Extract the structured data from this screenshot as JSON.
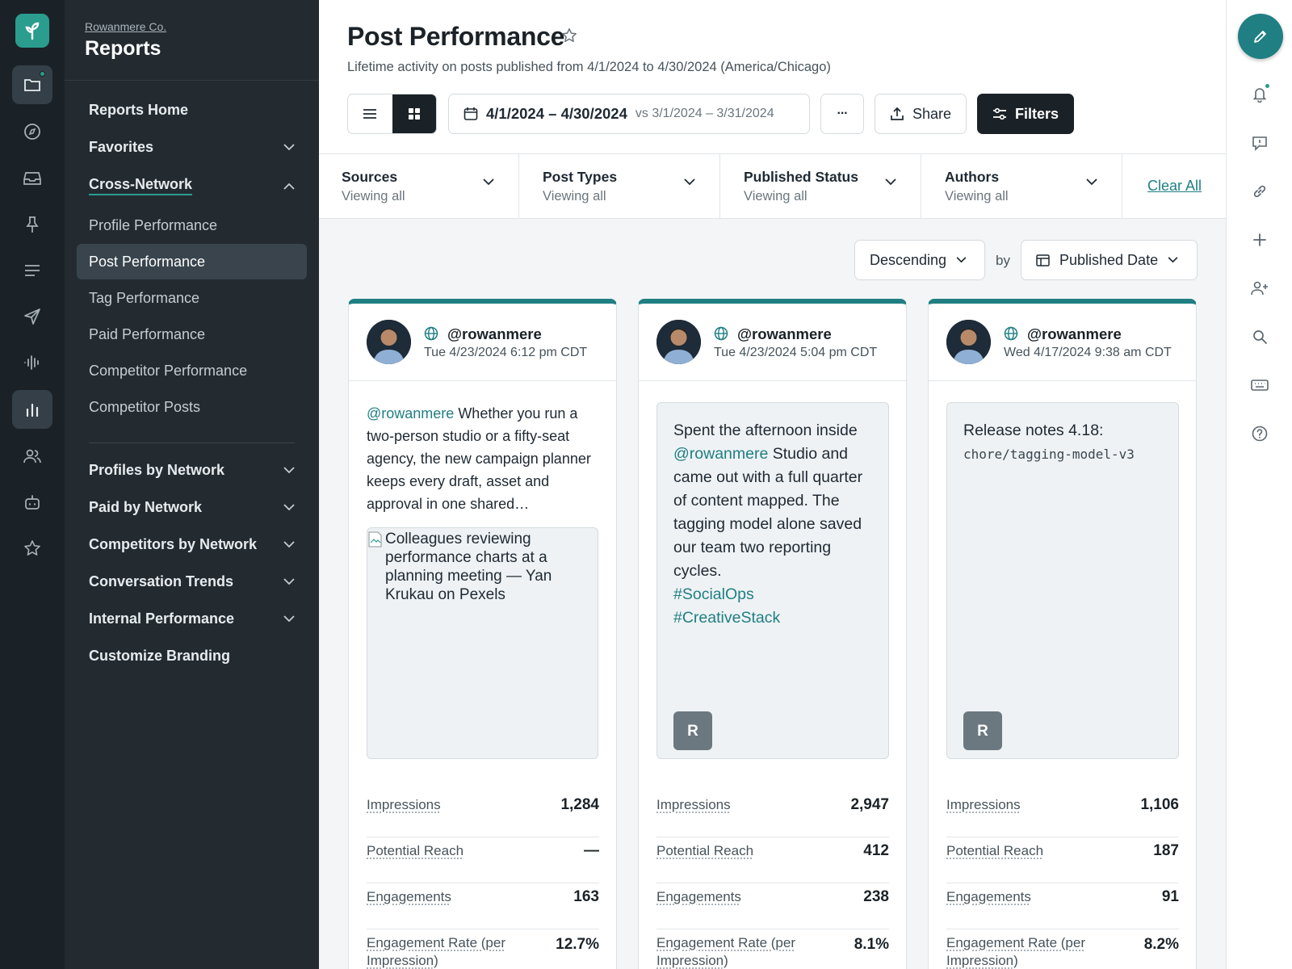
{
  "colors": {
    "accent": "#1f7f83",
    "rail_bg": "#1b2227",
    "nav_bg": "#232b31",
    "active_dark": "#1b2227"
  },
  "rail": {
    "icons": [
      "logo-icon",
      "folder-icon",
      "compass-icon",
      "inbox-icon",
      "pin-icon",
      "list-icon",
      "send-icon",
      "waveform-icon",
      "bar-chart-icon",
      "people-icon",
      "bot-icon",
      "star-icon"
    ]
  },
  "nav": {
    "org": "Rowanmere Co.",
    "title": "Reports",
    "items": {
      "reports_home": "Reports Home",
      "favorites": "Favorites",
      "cross_network": "Cross-Network",
      "profile_performance": "Profile Performance",
      "post_performance": "Post Performance",
      "tag_performance": "Tag Performance",
      "paid_performance": "Paid Performance",
      "competitor_performance": "Competitor Performance",
      "competitor_posts": "Competitor Posts",
      "profiles_by_network": "Profiles by Network",
      "paid_by_network": "Paid by Network",
      "competitors_by_network": "Competitors by Network",
      "conversation_trends": "Conversation Trends",
      "internal_performance": "Internal Performance",
      "customize_branding": "Customize Branding"
    }
  },
  "header": {
    "title": "Post Performance",
    "subtitle": "Lifetime activity on posts published from 4/1/2024 to 4/30/2024 (America/Chicago)",
    "date_range": "4/1/2024 – 4/30/2024",
    "compare_range": "vs 3/1/2024 – 3/31/2024",
    "more_label": "···",
    "share_label": "Share",
    "filters_label": "Filters"
  },
  "filters": {
    "sources": {
      "label": "Sources",
      "value": "Viewing all"
    },
    "post_types": {
      "label": "Post Types",
      "value": "Viewing all"
    },
    "published_status": {
      "label": "Published Status",
      "value": "Viewing all"
    },
    "authors": {
      "label": "Authors",
      "value": "Viewing all"
    },
    "clear_all": "Clear All"
  },
  "sort": {
    "order": "Descending",
    "by_label": "by",
    "field": "Published Date"
  },
  "cards": [
    {
      "handle": "@rowanmere",
      "time": "Tue 4/23/2024 6:12 pm CDT",
      "mention": "@rowanmere",
      "text": " Whether you run a two-person studio or a fifty-seat agency, the new campaign planner keeps every draft, asset and approval in one shared…",
      "image_alt": "Colleagues reviewing performance charts at a planning meeting — Yan Krukau on Pexels",
      "metrics": {
        "impressions_label": "Impressions",
        "impressions": "1,284",
        "reach_label": "Potential Reach",
        "reach": "—",
        "engagements_label": "Engagements",
        "engagements": "163",
        "rate_label": "Engagement Rate (per Impression)",
        "rate": "12.7%"
      }
    },
    {
      "handle": "@rowanmere",
      "time": "Tue 4/23/2024 5:04 pm CDT",
      "text_a": "Spent the afternoon inside ",
      "mention": "@rowanmere",
      "text_b": " Studio and came out with a full quarter of content mapped. The tagging model alone saved our team two reporting cycles.",
      "tag1": "#SocialOps",
      "tag2": "#CreativeStack",
      "badge": "R",
      "metrics": {
        "impressions_label": "Impressions",
        "impressions": "2,947",
        "reach_label": "Potential Reach",
        "reach": "412",
        "engagements_label": "Engagements",
        "engagements": "238",
        "rate_label": "Engagement Rate (per Impression)",
        "rate": "8.1%"
      }
    },
    {
      "handle": "@rowanmere",
      "time": "Wed 4/17/2024 9:38 am CDT",
      "text": "Release notes 4.18:",
      "code": "chore/tagging-model-v3",
      "badge": "R",
      "metrics": {
        "impressions_label": "Impressions",
        "impressions": "1,106",
        "reach_label": "Potential Reach",
        "reach": "187",
        "engagements_label": "Engagements",
        "engagements": "91",
        "rate_label": "Engagement Rate (per Impression)",
        "rate": "8.2%"
      }
    }
  ]
}
